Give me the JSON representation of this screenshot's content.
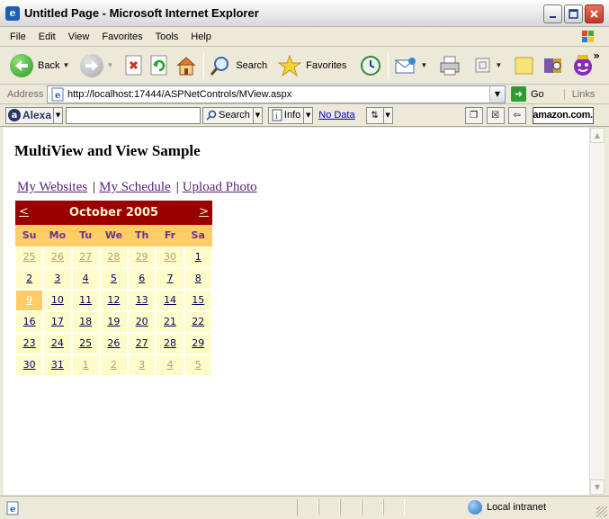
{
  "window": {
    "title": "Untitled Page - Microsoft Internet Explorer"
  },
  "menu": [
    "File",
    "Edit",
    "View",
    "Favorites",
    "Tools",
    "Help"
  ],
  "toolbar": {
    "back_label": "Back",
    "search_label": "Search",
    "favorites_label": "Favorites",
    "chevron": "»"
  },
  "address": {
    "label": "Address",
    "url": "http://localhost:17444/ASPNetControls/MView.aspx",
    "go_label": "Go",
    "links_label": "Links"
  },
  "alexa": {
    "brand": "Alexa",
    "search_label": "Search",
    "info_label": "Info",
    "nodata_label": "No Data",
    "amazon_label": "amazon.com."
  },
  "page": {
    "heading": "MultiView and View Sample",
    "links": [
      "My Websites",
      "My Schedule",
      "Upload Photo"
    ],
    "separator": "|"
  },
  "calendar": {
    "month_title": "October 2005",
    "prev": "<",
    "next": ">",
    "day_headers": [
      "Su",
      "Mo",
      "Tu",
      "We",
      "Th",
      "Fr",
      "Sa"
    ],
    "weeks": [
      [
        "25",
        "26",
        "27",
        "28",
        "29",
        "30",
        "1"
      ],
      [
        "2",
        "3",
        "4",
        "5",
        "6",
        "7",
        "8"
      ],
      [
        "9",
        "10",
        "11",
        "12",
        "13",
        "14",
        "15"
      ],
      [
        "16",
        "17",
        "18",
        "19",
        "20",
        "21",
        "22"
      ],
      [
        "23",
        "24",
        "25",
        "26",
        "27",
        "28",
        "29"
      ],
      [
        "30",
        "31",
        "1",
        "2",
        "3",
        "4",
        "5"
      ]
    ],
    "today": "9",
    "colors": {
      "title_bg": "#990000",
      "header_bg": "#ffcc66",
      "day_bg": "#fffcc9",
      "other_month_text": "#b3a26e"
    }
  },
  "status": {
    "zone_label": "Local intranet"
  },
  "icons": {
    "titlebar": "ie-page-icon",
    "back": "back-arrow-icon",
    "forward": "forward-arrow-icon",
    "stop": "stop-icon",
    "refresh": "refresh-icon",
    "home": "home-icon",
    "search": "search-icon",
    "favorites": "favorites-star-icon",
    "history": "history-icon",
    "mail": "mail-icon",
    "print": "print-icon",
    "edit": "edit-icon",
    "messenger": "messenger-icon"
  }
}
